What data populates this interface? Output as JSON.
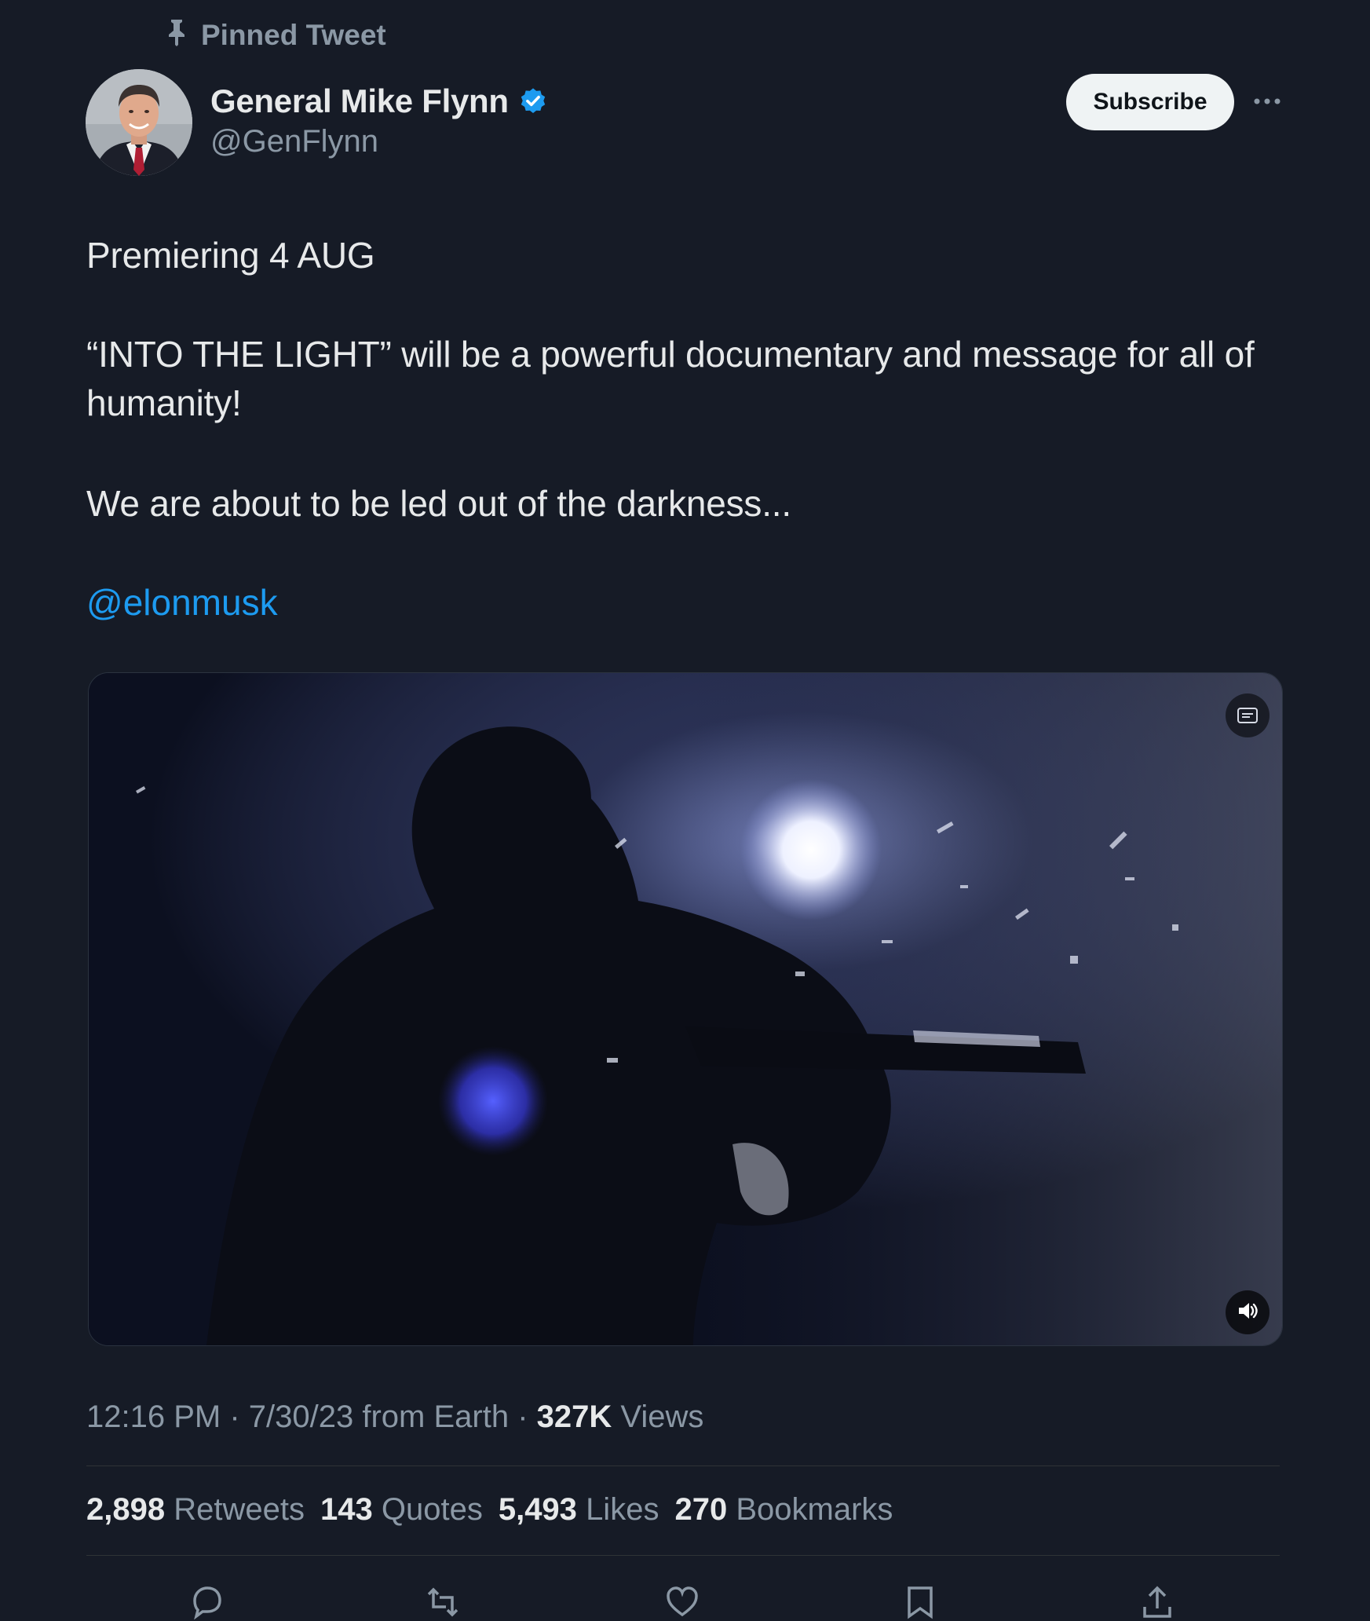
{
  "pinned": {
    "label": "Pinned Tweet",
    "icon": "pin-icon"
  },
  "author": {
    "name": "General Mike Flynn",
    "handle": "@GenFlynn",
    "verified": true,
    "verified_color": "#1d9bf0"
  },
  "header": {
    "subscribe_label": "Subscribe",
    "more_icon": "more-icon"
  },
  "tweet": {
    "line1": "Premiering 4 AUG",
    "line2": "“INTO THE LIGHT” will be a powerful documentary and message for all of humanity!",
    "line3": "We are about to be led out of the darkness...",
    "mention": "@elonmusk",
    "mention_color": "#1d9bf0"
  },
  "media": {
    "type": "video",
    "badge_icon": "gif-badge-icon",
    "volume_icon": "volume-icon"
  },
  "meta": {
    "time": "12:16 PM",
    "sep1": " · ",
    "date": "7/30/23",
    "source": " from Earth",
    "sep2": " · ",
    "views_count": "327K",
    "views_label": " Views"
  },
  "stats": [
    {
      "count": "2,898",
      "label": "Retweets"
    },
    {
      "count": "143",
      "label": "Quotes"
    },
    {
      "count": "5,493",
      "label": "Likes"
    },
    {
      "count": "270",
      "label": "Bookmarks"
    }
  ],
  "actions": [
    {
      "name": "reply",
      "icon": "reply-icon"
    },
    {
      "name": "retweet",
      "icon": "retweet-icon"
    },
    {
      "name": "like",
      "icon": "heart-icon"
    },
    {
      "name": "bookmark",
      "icon": "bookmark-icon"
    },
    {
      "name": "share",
      "icon": "share-icon"
    }
  ],
  "colors": {
    "background": "#161b26",
    "text_primary": "#e7e9ea",
    "text_secondary": "#8b98a5",
    "link": "#1d9bf0"
  }
}
